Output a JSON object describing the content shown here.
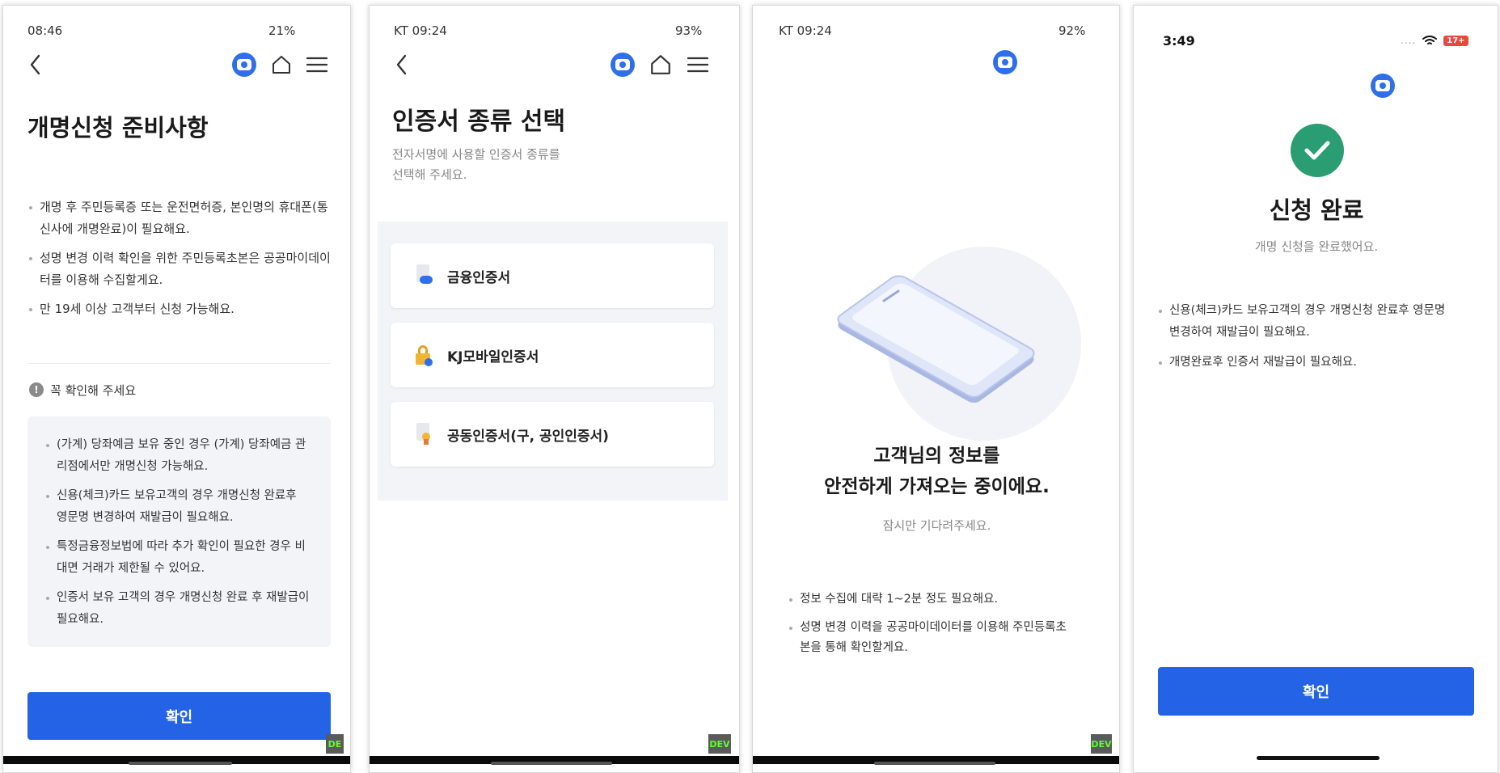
{
  "colors": {
    "accent": "#2563e6",
    "success": "#2a9d73",
    "notice_bg": "#f2f4f8"
  },
  "panel1": {
    "status_time": "08:46",
    "status_right": "21%",
    "title": "개명신청 준비사항",
    "items": [
      "개명 후 주민등록증 또는 운전면허증, 본인명의 휴대폰(통",
      "신사에 개명완료)이 필요해요.",
      "성명 변경 이력 확인을 위한 주민등록초본은 공공마이데이",
      "터를 이용해 수집할게요.",
      "만 19세 이상 고객부터 신청 가능해요."
    ],
    "notice_title": "꼭 확인해 주세요",
    "notices": [
      [
        "(가계) 당좌예금 보유 중인 경우 (가계) 당좌예금 관",
        "리점에서만 개명신청 가능해요."
      ],
      [
        "신용(체크)카드 보유고객의 경우 개명신청 완료후",
        "영문명 변경하여 재발급이 필요해요."
      ],
      [
        "특정금융정보법에 따라 추가 확인이 필요한 경우 비",
        "대면 거래가 제한될 수 있어요."
      ],
      [
        "인증서 보유 고객의 경우 개명신청 완료 후 재발급이",
        "필요해요."
      ]
    ],
    "confirm_label": "확인",
    "dev_tag": "DE"
  },
  "panel2": {
    "status_time": "KT 09:24",
    "status_right": "93%",
    "title": "인증서 종류 선택",
    "subtitle_1": "전자서명에 사용할 인증서 종류를",
    "subtitle_2": "선택해 주세요.",
    "certs": [
      "금융인증서",
      "KJ모바일인증서",
      "공동인증서(구, 공인인증서)"
    ],
    "dev_tag": "DEV"
  },
  "panel3": {
    "status_time": "KT 09:24",
    "status_right": "92%",
    "headline_1": "고객님의 정보를",
    "headline_2": "안전하게 가져오는 중이에요.",
    "sub": "잠시만 기다려주세요.",
    "notes": [
      "정보 수집에 대략 1~2분 정도 필요해요.",
      "성명 변경 이력을 공공마이데이터를 이용해 주민등록초",
      "본을 통해 확인할게요."
    ],
    "dev_tag": "DEV"
  },
  "panel4": {
    "status_time": "3:49",
    "battery": "17+",
    "title": "신청 완료",
    "sub": "개명 신청을 완료했어요.",
    "items": [
      "신용(체크)카드 보유고객의 경우 개명신청 완료후 영문명",
      "변경하여 재발급이 필요해요.",
      "개명완료후 인증서 재발급이 필요해요."
    ],
    "confirm_label": "확인"
  }
}
